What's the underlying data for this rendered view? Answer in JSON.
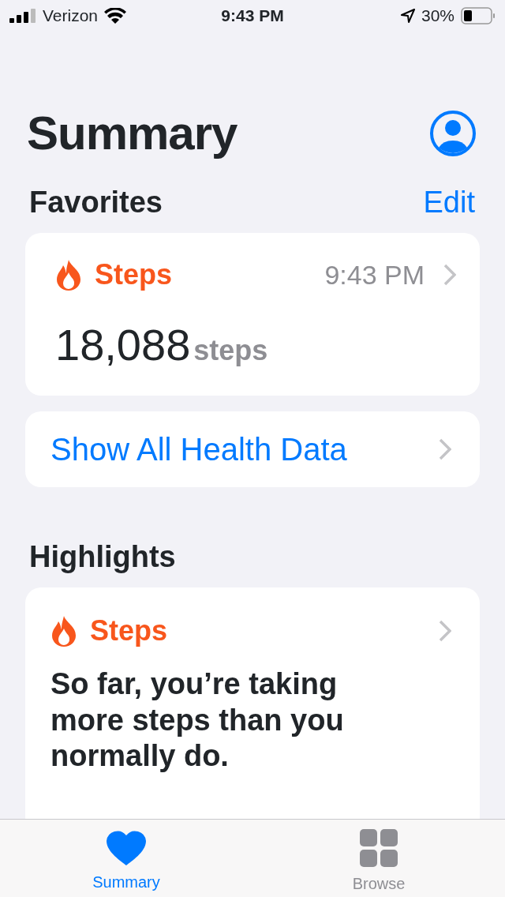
{
  "status_bar": {
    "carrier": "Verizon",
    "time": "9:43 PM",
    "battery": "30%"
  },
  "title": "Summary",
  "favorites": {
    "heading": "Favorites",
    "edit": "Edit",
    "card": {
      "label": "Steps",
      "time": "9:43 PM",
      "value": "18,088",
      "unit": "steps"
    },
    "show_all": "Show All Health Data"
  },
  "highlights": {
    "heading": "Highlights",
    "card": {
      "label": "Steps",
      "text": "So far, you’re taking more steps than you normally do."
    }
  },
  "tabs": [
    {
      "label": "Summary",
      "kind": "heart",
      "selected": true
    },
    {
      "label": "Browse",
      "kind": "grid",
      "selected": false
    }
  ]
}
